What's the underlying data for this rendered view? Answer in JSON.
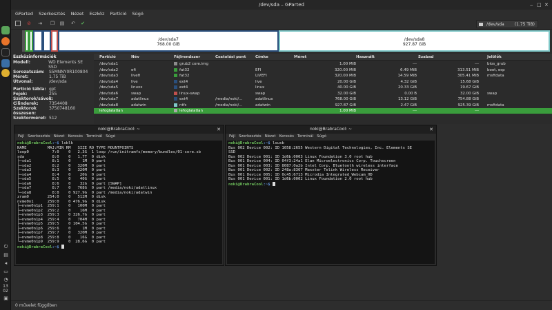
{
  "window": {
    "title": "/dev/sda – GParted"
  },
  "menu": [
    "GParted",
    "Szerkesztés",
    "Nézet",
    "Eszköz",
    "Partíció",
    "Súgó"
  ],
  "device_selector": {
    "name": "/dev/sda",
    "size": "(1.75 TiB)"
  },
  "graph": {
    "sda7": {
      "name": "/dev/sda7",
      "size": "768.00 GiB"
    },
    "sda8": {
      "name": "/dev/sda8",
      "size": "927.87 GiB"
    }
  },
  "info": {
    "heading": "Eszközinformációk",
    "rows": [
      {
        "k": "Modell:",
        "v": "WD Elements SE SSD"
      },
      {
        "k": "Sorozatszám:",
        "v": "S5MNNY0R100804"
      },
      {
        "k": "Méret:",
        "v": "1.75 TiB"
      },
      {
        "k": "Útvonal:",
        "v": "/dev/sda"
      }
    ],
    "rows2": [
      {
        "k": "Partíció tábla:",
        "v": "gpt"
      },
      {
        "k": "Fejek:",
        "v": "255"
      },
      {
        "k": "Szektorok/sávok:",
        "v": "2"
      },
      {
        "k": "Cilinderek:",
        "v": "7354408"
      },
      {
        "k": "Szektorok összesen:",
        "v": "3750748160"
      },
      {
        "k": "Szektorméret:",
        "v": "512"
      }
    ]
  },
  "table": {
    "headers": [
      "Partíció",
      "Név",
      "Fájlrendszer",
      "Csatolási pont",
      "Címke",
      "Méret",
      "Használt",
      "Szabad",
      "Jelölők"
    ],
    "rows": [
      {
        "part": "/dev/sda1",
        "name": "",
        "fs": "grub2 core.img",
        "fscolor": "#8c8c8c",
        "mount": "",
        "label": "",
        "size": "1.00 MiB",
        "used": "---",
        "free": "---",
        "flags": "bios_grub"
      },
      {
        "part": "/dev/sda2",
        "name": "efi",
        "fs": "fat32",
        "fscolor": "#3a9d3c",
        "mount": "",
        "label": "EFI",
        "size": "320.00 MiB",
        "used": "6.49 MiB",
        "free": "313.51 MiB",
        "flags": "boot, esp"
      },
      {
        "part": "/dev/sda3",
        "name": "livefi",
        "fs": "fat32",
        "fscolor": "#3a9d3c",
        "mount": "",
        "label": "LIVEFI",
        "size": "320.00 MiB",
        "used": "14.59 MiB",
        "free": "305.41 MiB",
        "flags": "msftdata"
      },
      {
        "part": "/dev/sda4",
        "name": "live",
        "fs": "ext4",
        "fscolor": "#2a4f7c",
        "mount": "",
        "label": "live",
        "size": "20.00 GiB",
        "used": "4.32 GiB",
        "free": "15.68 GiB",
        "flags": ""
      },
      {
        "part": "/dev/sda5",
        "name": "linuxx",
        "fs": "ext4",
        "fscolor": "#2a4f7c",
        "mount": "",
        "label": "linux",
        "size": "40.00 GiB",
        "used": "20.33 GiB",
        "free": "19.67 GiB",
        "flags": ""
      },
      {
        "part": "/dev/sda6",
        "name": "swap",
        "fs": "linux-swap",
        "fscolor": "#c0504d",
        "mount": "",
        "label": "swap",
        "size": "32.00 GiB",
        "used": "0.00 B",
        "free": "32.00 GiB",
        "flags": "swap"
      },
      {
        "part": "/dev/sda7",
        "name": "adatlinux",
        "fs": "ext4",
        "fscolor": "#2a4f7c",
        "mount": "/media/noki/...",
        "label": "adatlinux",
        "size": "768.00 GiB",
        "used": "13.12 GiB",
        "free": "754.88 GiB",
        "flags": ""
      },
      {
        "part": "/dev/sda8",
        "name": "adatwin",
        "fs": "ntfs",
        "fscolor": "#7ec8c8",
        "mount": "/media/noki/...",
        "label": "adatwin",
        "size": "927.87 GiB",
        "used": "2.47 GiB",
        "free": "925.39 GiB",
        "flags": "msftdata"
      },
      {
        "part": "lefoglalatlan",
        "name": "",
        "fs": "lefoglalatlan",
        "fscolor": "#aaaaaa",
        "mount": "",
        "label": "",
        "size": "1.00 MiB",
        "used": "---",
        "free": "---",
        "flags": ""
      }
    ]
  },
  "term1": {
    "title": "noki@BrabraCool: ~",
    "menu": [
      "Fájl",
      "Szerkesztés",
      "Nézet",
      "Keresés",
      "Terminál",
      "Súgó"
    ],
    "prompt_user": "noki@BrabraCool",
    "prompt_path": ":~$",
    "command": " lsblk",
    "output": "NAME         MAJ:MIN RM   SIZE RO TYPE MOUNTPOINTS\nloop0          7:0    0   2,3G  1 loop /run/initramfs/memory/bundles/01-core.sb\nsda            8:0    0   1,7T  0 disk\n├─sda1         8:1    0     1M  0 part\n├─sda2         8:2    0   320M  0 part\n├─sda3         8:3    0   320M  0 part\n├─sda4         8:4    0    20G  0 part\n├─sda5         8:5    0    40G  0 part\n├─sda6         8:6    0    32G  0 part [SWAP]\n├─sda7         8:7    0   768G  0 part /media/noki/adatlinux\n└─sda8         8:8    0 927,9G  0 part /media/noki/adatwin\nzram0        254:0    0   512M  0 disk\nnvme0n1      259:0    0 476,9G  0 disk\n├─nvme0n1p1  259:1    0   100M  0 part\n├─nvme0n1p2  259:2    0    16M  0 part\n├─nvme0n1p3  259:3    0 326,7G  0 part\n├─nvme0n1p4  259:4    0   704M  0 part\n├─nvme0n1p5  259:5    0 104,5G  0 part\n├─nvme0n1p6  259:6    0     1M  0 part\n├─nvme0n1p7  259:7    0   320M  0 part\n├─nvme0n1p8  259:8    0    16G  0 part\n└─nvme0n1p9  259:9    0  28,6G  0 part"
  },
  "term2": {
    "title": "noki@BrabraCool: ~",
    "menu": [
      "Fájl",
      "Szerkesztés",
      "Nézet",
      "Keresés",
      "Terminál",
      "Súgó"
    ],
    "prompt_user": "noki@BrabraCool",
    "prompt_path": ":~$",
    "command": " lsusb",
    "output": "Bus 002 Device 002: ID 1058:2655 Western Digital Technologies, Inc. Elements SE\nSSD\nBus 002 Device 001: ID 1d6b:0003 Linux Foundation 3.0 root hub\nBus 001 Device 004: ID 04f3:24a1 Elan Microelectronics Corp. Touchscreen\nBus 001 Device 003: ID 8087:0a2b Intel Corp. Bluetooth wireless interface\nBus 001 Device 002: ID 248a:8367 Maxxter Telink Wireless Receiver\nBus 001 Device 005: ID 0c45:6713 Microdia Integrated_Webcam_HD\nBus 001 Device 001: ID 1d6b:0002 Linux Foundation 2.0 root hub"
  },
  "clock": {
    "h": "13",
    "m": "02"
  },
  "status": "0 művelet függőben"
}
